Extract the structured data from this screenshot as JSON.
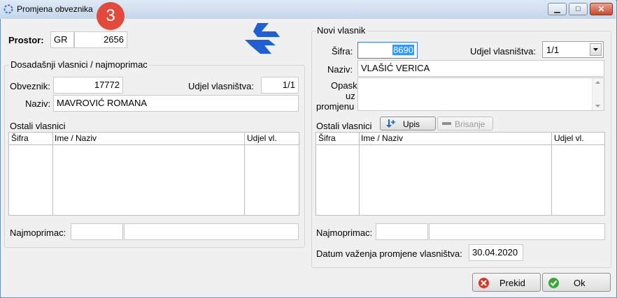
{
  "window": {
    "title": "Promjena obveznika",
    "badge": "3",
    "minimize": "▁",
    "maximize": "□",
    "close": "✕"
  },
  "prostor": {
    "label": "Prostor:",
    "code": "GR",
    "number": "2656"
  },
  "left": {
    "group_title": "Dosadašnji vlasnici / najmoprimac",
    "obveznik_label": "Obveznik:",
    "obveznik_value": "17772",
    "udjel_label": "Udjel vlasništva:",
    "udjel_value": "1/1",
    "naziv_label": "Naziv:",
    "naziv_value": "MAVROVIĆ ROMANA",
    "ostali_label": "Ostali vlasnici",
    "grid_headers": [
      "Šifra",
      "Ime / Naziv",
      "Udjel vl."
    ],
    "najmoprimac_label": "Najmoprimac:"
  },
  "right": {
    "group_title": "Novi vlasnik",
    "sifra_label": "Šifra:",
    "sifra_value": "8690",
    "udjel_label": "Udjel vlasništva:",
    "udjel_value": "1/1",
    "naziv_label": "Naziv:",
    "naziv_value": "VLAŠIĆ VERICA",
    "opaska_label_1": "Opaska",
    "opaska_label_2": "uz",
    "opaska_label_3": "promjenu",
    "opaska_value": "",
    "ostali_label": "Ostali vlasnici",
    "upis_button": "Upis",
    "brisanje_button": "Brisanje",
    "grid_headers": [
      "Šifra",
      "Ime / Naziv",
      "Udjel vl."
    ],
    "najmoprimac_label": "Najmoprimac:",
    "datum_label": "Datum važenja promjene vlasništva:",
    "datum_value": "30.04.2020"
  },
  "footer": {
    "prekid_button": "Prekid",
    "ok_button": "Ok"
  },
  "colors": {
    "accent_blue": "#1f5fd6",
    "selection": "#3399ff",
    "badge_red": "#e24b3b"
  }
}
